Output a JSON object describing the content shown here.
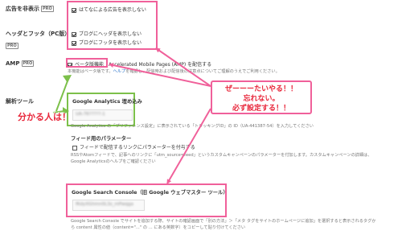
{
  "sections": {
    "ad_hide": {
      "label": "広告を非表示",
      "pro": "PRO",
      "option": "はてなによる広告を表示しない"
    },
    "header_footer": {
      "label": "ヘッダとフッタ（PC版）",
      "pro": "PRO",
      "options": [
        "ブログにヘッダを表示しない",
        "ブログにフッタを表示しない"
      ]
    },
    "amp": {
      "label": "AMP",
      "pro": "PRO",
      "checkbox_label": "ベータ版機能",
      "option_rest": "Accelerated Mobile Pages (AMP) を配信する",
      "desc_prefix": "本機能はベータ版です。",
      "desc_link": "ヘルプ",
      "desc_suffix": "を確認し、配信時および配信後の注意点についてご理解のうえでご利用ください。"
    },
    "analysis": {
      "label": "解析ツール",
      "ga": {
        "title": "Google Analytics 埋め込み",
        "value": "UA-76?????-1",
        "desc": "Google Analytics の「プリファレンス設定」に表示されている「トラッキングID」の ID（UA-441387-54）を入力してください"
      },
      "feed": {
        "title": "フィード用のパラメーター",
        "option": "フィードで配信するリンクにパラメーターを付与する",
        "desc1": "RSSやAtomフィードで、記事へのリンクに「utm_source=feed」というカスタムキャンペーンのパラメーターを付加します。カスタムキャンペーンの詳細は、",
        "desc2": "Google Analyticsのヘルプをご確認ください"
      },
      "gsc": {
        "title": "Google Search Console（旧 Google ウェブマスター ツール）",
        "value": "fKdyXGhmn0L3z_mPwqga",
        "desc1": "Google Search Console でサイトを追加する際、サイトの確認画面で「別の方法」＞「メタ タグをサイトのホームページに追加」を選択すると表示されるタグか",
        "desc2": "ら content 属性の値（content=\"...\" の ... にある英数字）をコピーして貼り付けてください"
      }
    }
  },
  "annotations": {
    "left_callout": "分かる人は！",
    "speech_lines": [
      "ぜーーーたいやる！！",
      "忘れない。",
      "必ず設定する！！"
    ]
  },
  "colors": {
    "green": "#7cc04a",
    "pink": "#f0609a",
    "red_text": "#e8263a",
    "link": "#2a73c9"
  }
}
